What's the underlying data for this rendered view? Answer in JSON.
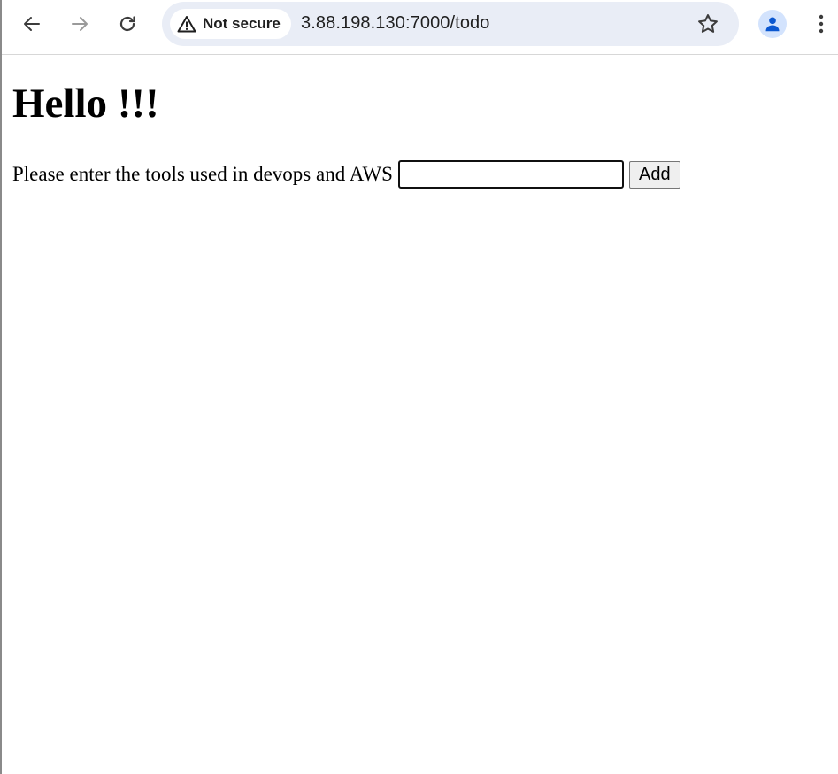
{
  "browser": {
    "security_label": "Not secure",
    "url": "3.88.198.130:7000/todo",
    "icons": {
      "back": "arrow-left-icon",
      "forward": "arrow-right-icon",
      "reload": "reload-icon",
      "security": "warning-triangle-icon",
      "bookmark": "star-icon",
      "profile": "person-icon",
      "menu": "three-dots-vertical-icon"
    },
    "colors": {
      "omnibox_bg": "#e9edf6",
      "profile_bg": "#d3e3fd",
      "profile_icon": "#0b57d0",
      "icon_active": "#3c3c3c",
      "icon_disabled": "#9a9a9a"
    }
  },
  "page": {
    "heading": "Hello !!!",
    "form": {
      "label": "Please enter the tools used in devops and AWS",
      "input_value": "",
      "add_button": "Add"
    }
  }
}
